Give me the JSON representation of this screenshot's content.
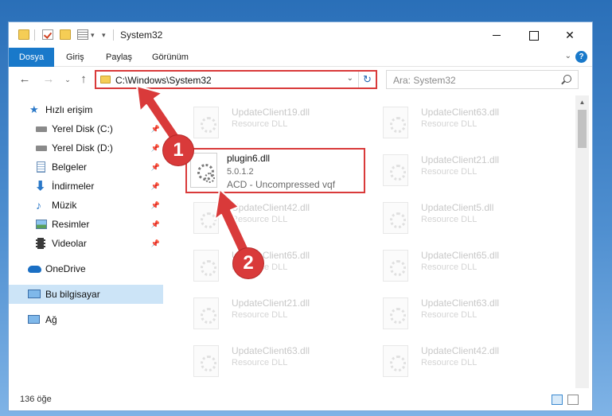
{
  "window": {
    "title": "System32"
  },
  "ribbon": {
    "tabs": [
      "Dosya",
      "Giriş",
      "Paylaş",
      "Görünüm"
    ]
  },
  "navigation": {
    "address": "C:\\Windows\\System32",
    "search_placeholder": "Ara: System32"
  },
  "sidebar": {
    "quick_access": "Hızlı erişim",
    "items": [
      {
        "label": "Yerel Disk (C:)",
        "icon": "drive-c-icon",
        "pinned": true
      },
      {
        "label": "Yerel Disk (D:)",
        "icon": "drive-d-icon",
        "pinned": true
      },
      {
        "label": "Belgeler",
        "icon": "documents-icon",
        "pinned": true
      },
      {
        "label": "İndirmeler",
        "icon": "downloads-icon",
        "pinned": true
      },
      {
        "label": "Müzik",
        "icon": "music-icon",
        "pinned": true
      },
      {
        "label": "Resimler",
        "icon": "pictures-icon",
        "pinned": true
      },
      {
        "label": "Videolar",
        "icon": "videos-icon",
        "pinned": true
      }
    ],
    "onedrive": "OneDrive",
    "this_pc": "Bu bilgisayar",
    "network": "Ağ"
  },
  "files": {
    "left": [
      {
        "name": "UpdateClient19.dll",
        "type": "Resource DLL"
      },
      {
        "name": "UpdateClient42.dll",
        "type": "Resource DLL"
      },
      {
        "name": "UpdateClient65.dll",
        "type": "Resource DLL"
      },
      {
        "name": "UpdateClient21.dll",
        "type": "Resource DLL"
      },
      {
        "name": "UpdateClient63.dll",
        "type": "Resource DLL"
      }
    ],
    "right": [
      {
        "name": "UpdateClient63.dll",
        "type": "Resource DLL"
      },
      {
        "name": "UpdateClient21.dll",
        "type": "Resource DLL"
      },
      {
        "name": "UpdateClient5.dll",
        "type": "Resource DLL"
      },
      {
        "name": "UpdateClient65.dll",
        "type": "Resource DLL"
      },
      {
        "name": "UpdateClient63.dll",
        "type": "Resource DLL"
      },
      {
        "name": "UpdateClient42.dll",
        "type": "Resource DLL"
      }
    ],
    "highlighted": {
      "name": "plugin6.dll",
      "version": "5.0.1.2",
      "description": "ACD - Uncompressed vqf"
    }
  },
  "status": {
    "item_count": "136 öğe"
  },
  "annotations": {
    "callout_1": "1",
    "callout_2": "2",
    "color": "#d93a3a"
  }
}
